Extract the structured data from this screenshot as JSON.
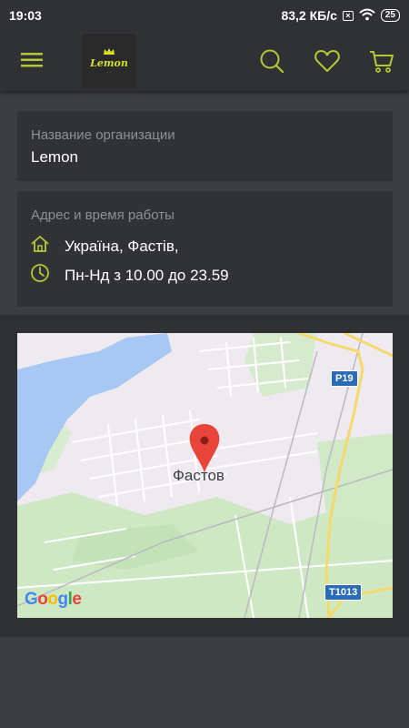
{
  "status_bar": {
    "time": "19:03",
    "speed": "83,2 КБ/с",
    "battery": "25",
    "icons": [
      "no-sim-icon",
      "wifi-icon",
      "battery-icon"
    ]
  },
  "app_bar": {
    "logo_text": "Lemon",
    "icons": [
      "menu-icon",
      "search-icon",
      "heart-icon",
      "cart-icon"
    ],
    "accent_color": "#b5c934"
  },
  "organization": {
    "title": "Название организации",
    "name": "Lemon"
  },
  "address": {
    "title": "Адрес и время работы",
    "location": "Україна, Фастів,",
    "hours": "Пн-Нд з 10.00 до 23.59"
  },
  "map": {
    "city_label": "Фастов",
    "route_labels": [
      "P19",
      "T1013"
    ],
    "attribution": "Google"
  }
}
